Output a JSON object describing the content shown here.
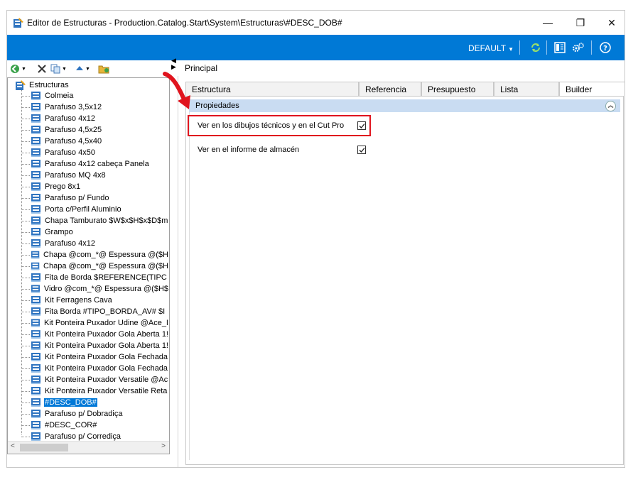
{
  "window": {
    "title": "Editor de Estructuras - Production.Catalog.Start\\System\\Estructuras\\#DESC_DOB#",
    "minimize_glyph": "—",
    "restore_glyph": "❐",
    "close_glyph": "✕"
  },
  "toolbar": {
    "profile_label": "DEFAULT",
    "icons": [
      "refresh-icon",
      "layout-icon",
      "settings-icon",
      "help-icon"
    ],
    "accent_color": "#0079d6"
  },
  "left_toolbar": {
    "icons": [
      "add-icon",
      "delete-icon",
      "copy-icon",
      "move-up-icon",
      "folder-icon"
    ]
  },
  "tree": {
    "root_label": "Estructuras",
    "items": [
      "Colmeia",
      "Parafuso 3,5x12",
      "Parafuso 4x12",
      "Parafuso 4,5x25",
      "Parafuso 4,5x40",
      "Parafuso 4x50",
      "Parafuso 4x12  cabeça Panela",
      "Parafuso MQ 4x8",
      "Prego 8x1",
      "Parafuso p/ Fundo",
      "Porta c/Perfil Aluminio",
      "Chapa Tamburato $W$x$H$x$D$m",
      "Grampo",
      "Parafuso 4x12",
      "Chapa @com_*@ Espessura @($H",
      "Chapa @com_*@ Espessura @($H",
      "Fita de Borda $REFERENCE(TIPC",
      "Vidro @com_*@ Espessura @($H$",
      "Kit Ferragens Cava",
      "Fita Borda #TIPO_BORDA_AV# $I",
      "Kit Ponteira Puxador Udine @Ace_I",
      "Kit Ponteira Puxador Gola Aberta 1!",
      "Kit Ponteira Puxador Gola Aberta 1!",
      "Kit Ponteira Puxador Gola Fechada",
      "Kit Ponteira Puxador Gola Fechada",
      "Kit Ponteira Puxador Versatile @Ac",
      "Kit Ponteira Puxador Versatile Reta",
      "#DESC_DOB#",
      "Parafuso p/ Dobradiça",
      "#DESC_COR#",
      "Parafuso p/ Corrediça"
    ],
    "selected_index": 27
  },
  "right": {
    "breadcrumb": "Principal",
    "tabs": [
      "Estructura",
      "Referencia",
      "Presupuesto",
      "Lista",
      "Builder"
    ],
    "active_tab": "Builder",
    "section_title": "Propiedades",
    "properties": [
      {
        "label": "Ver en los dibujos técnicos y en el Cut Pro",
        "checked": true
      },
      {
        "label": "Ver en el informe de almacén",
        "checked": true
      }
    ]
  }
}
